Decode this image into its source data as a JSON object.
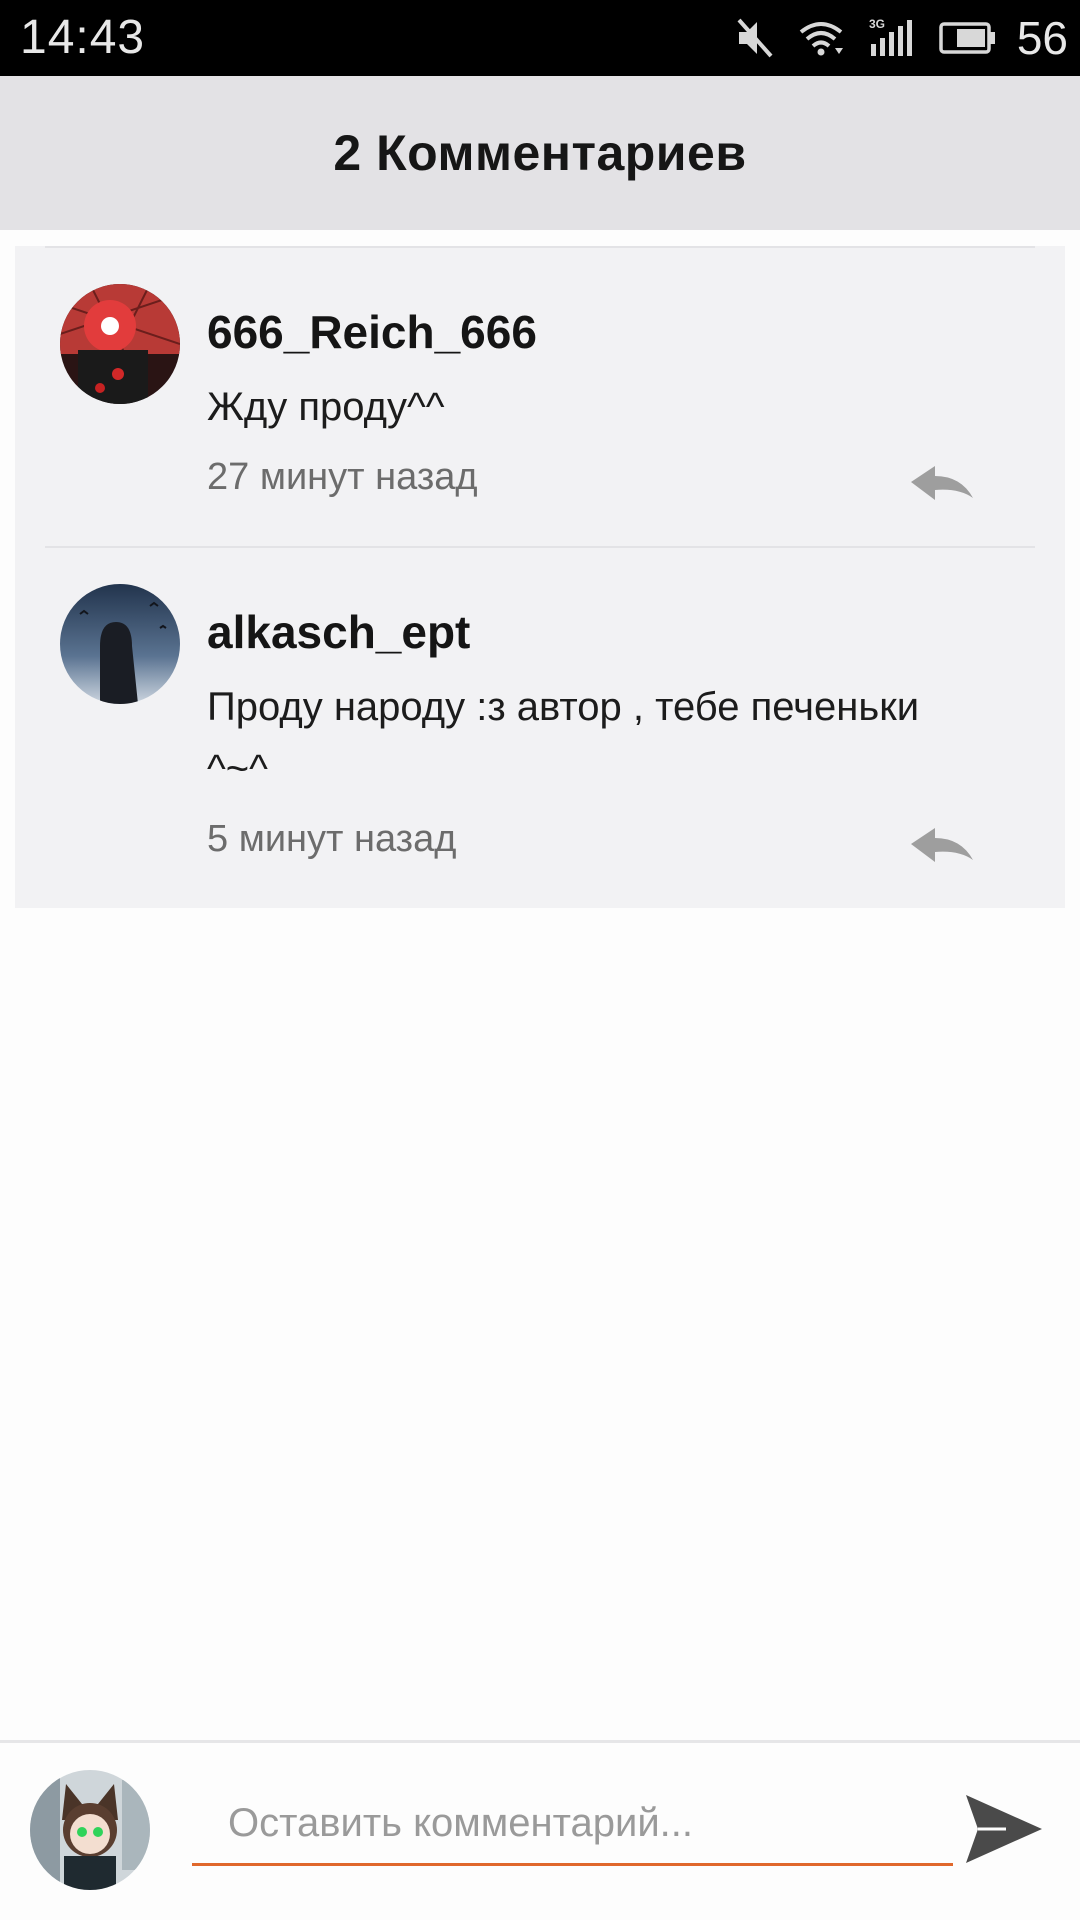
{
  "status_bar": {
    "time": "14:43",
    "battery": "56",
    "network_label": "3G",
    "icons": [
      "mute-icon",
      "wifi-icon",
      "signal-3g-icon",
      "battery-icon"
    ]
  },
  "header": {
    "title": "2 Комментариев"
  },
  "comments": [
    {
      "username": "666_Reich_666",
      "text": "Жду проду^^",
      "time": "27 минут назад",
      "avatar": "avatar-red-ball-character"
    },
    {
      "username": "alkasch_ept",
      "text": "Проду народу :з автор , тебе печеньки ^~^",
      "time": "5 минут назад",
      "avatar": "avatar-dark-silhouette-sky"
    }
  ],
  "composer": {
    "placeholder": "Оставить комментарий...",
    "value": "",
    "avatar": "avatar-anime-cat-girl",
    "send_icon": "send-icon"
  },
  "colors": {
    "status_bar_bg": "#000000",
    "header_bg": "#e3e2e5",
    "comments_bg": "#f2f2f4",
    "accent_underline": "#e0682c",
    "reply_icon": "#9e9e9e",
    "send_icon": "#4a4a4a"
  }
}
